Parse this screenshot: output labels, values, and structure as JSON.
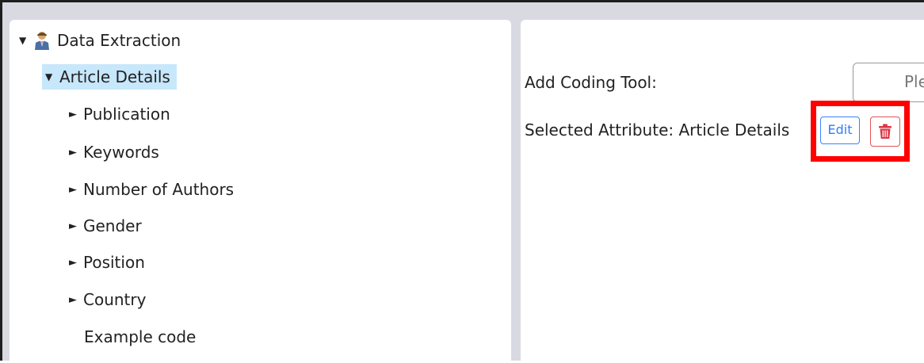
{
  "tree": {
    "root": {
      "label": "Data Extraction",
      "icon": "person-icon"
    },
    "selected": {
      "label": "Article Details"
    },
    "children": [
      {
        "label": "Publication"
      },
      {
        "label": "Keywords"
      },
      {
        "label": "Number of Authors"
      },
      {
        "label": "Gender"
      },
      {
        "label": "Position"
      },
      {
        "label": "Country"
      }
    ],
    "leaf": {
      "label": "Example code"
    }
  },
  "details": {
    "add_tool_label": "Add Coding Tool:",
    "tool_placeholder": "Ple",
    "selected_attribute": "Selected Attribute: Article Details",
    "edit_label": "Edit",
    "delete_icon": "trash-icon"
  },
  "colors": {
    "selection": "#c7e7fb",
    "edit_accent": "#2f7ef5",
    "delete_accent": "#e55353",
    "highlight": "#ff0000"
  }
}
